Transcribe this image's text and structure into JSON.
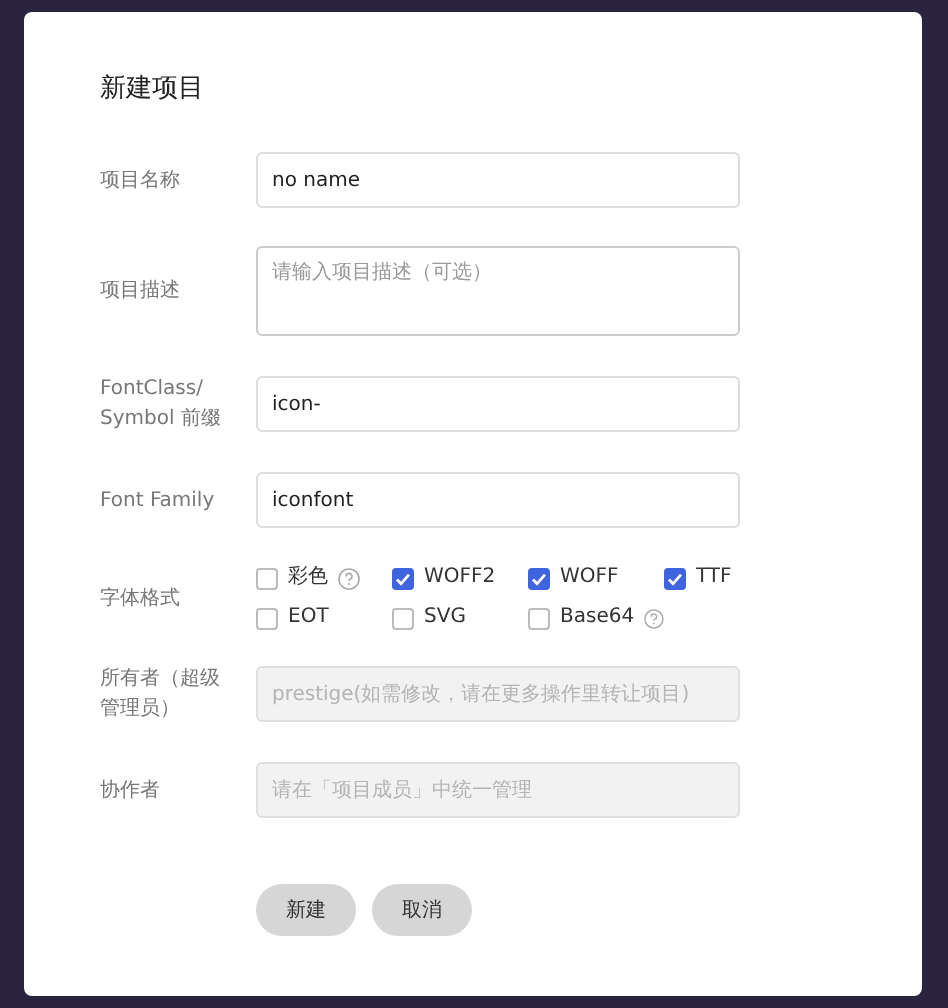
{
  "dialog": {
    "title": "新建项目",
    "fields": [
      {
        "kind": "input",
        "label": "项目名称",
        "value": "no name",
        "disabled": false
      },
      {
        "kind": "textarea",
        "label": "项目描述",
        "placeholder": "请输入项目描述（可选）",
        "disabled": false
      },
      {
        "kind": "input",
        "label": "FontClass/ Symbol 前缀",
        "value": "icon-",
        "disabled": false
      },
      {
        "kind": "input",
        "label": "Font Family",
        "value": "iconfont",
        "disabled": false
      },
      {
        "kind": "checks",
        "label": "字体格式",
        "options": [
          {
            "label": "彩色",
            "checked": false,
            "help": true
          },
          {
            "label": "WOFF2",
            "checked": true,
            "help": false
          },
          {
            "label": "WOFF",
            "checked": true,
            "help": false
          },
          {
            "label": "TTF",
            "checked": true,
            "help": false
          },
          {
            "label": "EOT",
            "checked": false,
            "help": false
          },
          {
            "label": "SVG",
            "checked": false,
            "help": false
          },
          {
            "label": "Base64",
            "checked": false,
            "help": true
          }
        ]
      },
      {
        "kind": "input",
        "label": "所有者（超级管理员）",
        "placeholder": "prestige(如需修改，请在更多操作里转让项目)",
        "disabled": true
      },
      {
        "kind": "input",
        "label": "协作者",
        "placeholder": "请在「项目成员」中统一管理",
        "disabled": true
      }
    ],
    "buttons": [
      "新建",
      "取消"
    ]
  }
}
